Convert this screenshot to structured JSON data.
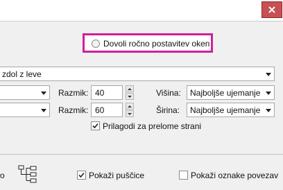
{
  "window": {
    "close_icon": "close-x-icon",
    "accent_close": "#c85052",
    "highlight_color": "#d21e9b"
  },
  "options": {
    "manual_windows_radio_label": "Dovoli ročno postavitev oken",
    "layout_dropdown_value": "zdol z leve",
    "row1": {
      "left_dropdown_value": "",
      "spacing_label": "Razmik:",
      "spacing_value": "40",
      "height_label": "Višina:",
      "height_dropdown_value": "Najboljše ujemanje"
    },
    "row2": {
      "left_dropdown_value": "",
      "spacing_label": "Razmik:",
      "spacing_value": "60",
      "width_label": "Širina:",
      "width_dropdown_value": "Najboljše ujemanje"
    },
    "fit_page_breaks_label": "Prilagodi za prelome strani",
    "fit_page_breaks_checked": true
  },
  "bottom": {
    "left_truncated_text": "o",
    "tree_icon": "tree-hierarchy-icon",
    "show_arrows_label": "Pokaži puščice",
    "show_arrows_checked": true,
    "show_link_labels_label": "Pokaži oznake povezav",
    "show_link_labels_checked": false
  }
}
